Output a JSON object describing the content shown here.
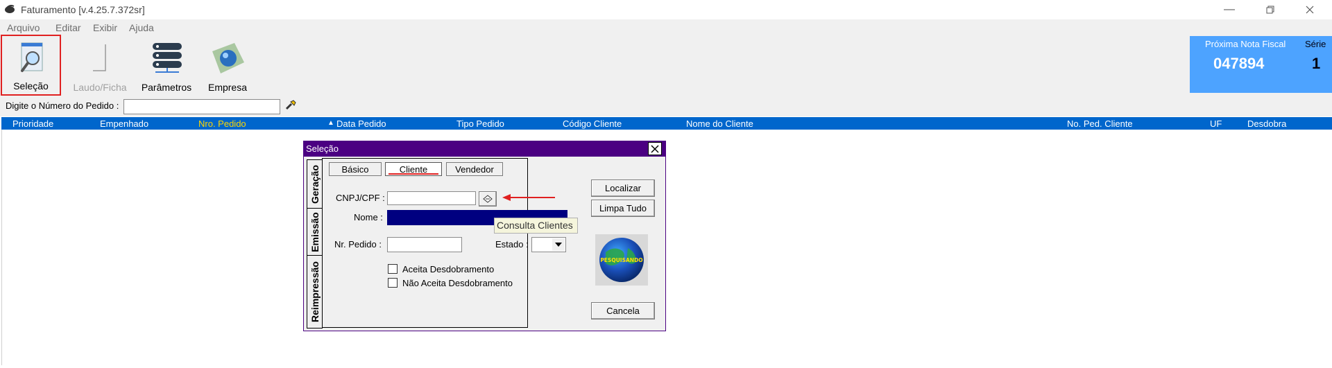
{
  "window": {
    "title": "Faturamento [v.4.25.7.372sr]",
    "controls": [
      "minimize",
      "restore",
      "close"
    ]
  },
  "menu": [
    "Arquivo",
    "Editar",
    "Exibir",
    "Ajuda"
  ],
  "toolbar": {
    "buttons": [
      {
        "label": "Seleção",
        "icon": "selection-search-icon",
        "enabled": true,
        "highlighted": true
      },
      {
        "label": "Laudo/Ficha",
        "icon": "report-icon",
        "enabled": false
      },
      {
        "label": "Parâmetros",
        "icon": "server-stack-icon",
        "enabled": true
      },
      {
        "label": "Empresa",
        "icon": "company-globe-icon",
        "enabled": true
      }
    ]
  },
  "next_invoice": {
    "label": "Próxima Nota Fiscal",
    "number": "047894",
    "series_label": "Série",
    "series": "1"
  },
  "search": {
    "label": "Digite o Número do Pedido :",
    "value": ""
  },
  "grid": {
    "columns": [
      "Prioridade",
      "Empenhado",
      "Nro. Pedido",
      "Data Pedido",
      "Tipo Pedido",
      "Código Cliente",
      "Nome do Cliente",
      "No. Ped. Cliente",
      "UF",
      "Desdobra"
    ],
    "highlighted_column": "Nro. Pedido",
    "sort_indicator": "▲",
    "rows": []
  },
  "dialog": {
    "title": "Seleção",
    "vertical_tabs": [
      "Geração",
      "Emissão",
      "Reimpressão"
    ],
    "active_vertical_tab": "Geração",
    "tabs": [
      "Básico",
      "Cliente",
      "Vendedor"
    ],
    "active_tab": "Cliente",
    "fields": {
      "cnpj_label": "CNPJ/CPF :",
      "cnpj_value": "",
      "nome_label": "Nome :",
      "nome_value": "",
      "pedido_label": "Nr. Pedido :",
      "pedido_value": "",
      "estado_label": "Estado :",
      "estado_value": ""
    },
    "tooltip": "Consulta Clientes",
    "checkboxes": [
      {
        "label": "Aceita Desdobramento",
        "checked": false
      },
      {
        "label": "Não Aceita Desdobramento",
        "checked": false
      }
    ],
    "buttons": {
      "localizar": "Localizar",
      "limpa_tudo": "Limpa Tudo",
      "cancela": "Cancela"
    },
    "globe_text": "PESQUISANDO"
  },
  "colors": {
    "grid_header": "#0066cc",
    "dialog_title": "#4b0082",
    "panel_blue": "#4da3ff",
    "highlight_red": "#e02020",
    "nome_field": "#000080"
  }
}
